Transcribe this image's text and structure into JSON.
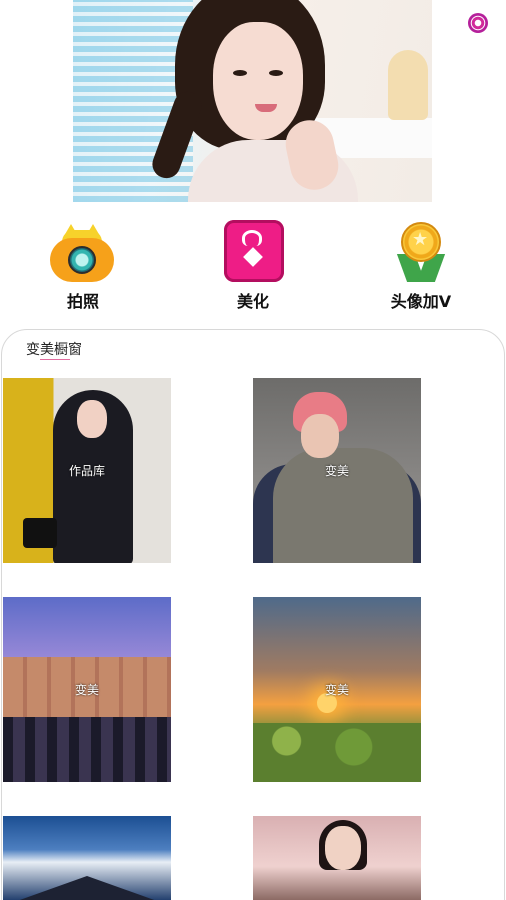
{
  "banner": {
    "image_desc": "banner photo"
  },
  "features": [
    {
      "label": "拍照",
      "icon": "camera-icon"
    },
    {
      "label": "美化",
      "icon": "gift-heart-icon"
    },
    {
      "label": "头像加V",
      "icon": "medal-icon"
    }
  ],
  "showcase": {
    "title": "变美橱窗",
    "tiles": [
      {
        "caption": "作品库"
      },
      {
        "caption": "变美"
      },
      {
        "caption": "变美"
      },
      {
        "caption": "变美"
      },
      {
        "caption": ""
      },
      {
        "caption": ""
      }
    ]
  },
  "colors": {
    "accent": "#ee1d86",
    "medal": "#f0a81a",
    "camera": "#f6a11a"
  }
}
